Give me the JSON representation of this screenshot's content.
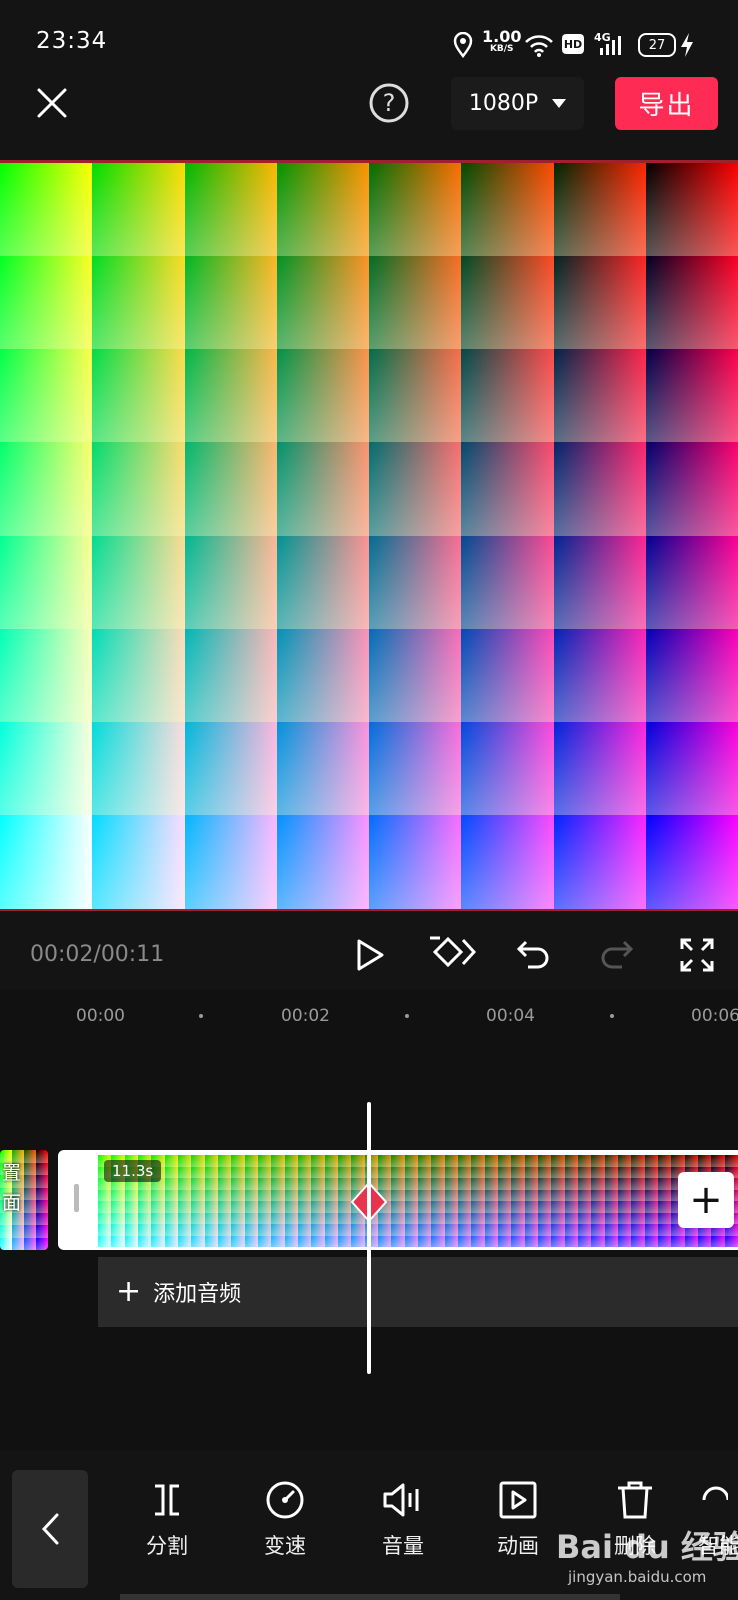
{
  "status_bar": {
    "time": "23:34",
    "speed_value": "1.00",
    "speed_unit": "KB/S",
    "hd": "HD",
    "network": "4G",
    "battery": "27",
    "icons": [
      "location-icon",
      "wifi-icon",
      "signal-icon",
      "battery-icon",
      "charging-icon"
    ]
  },
  "topbar": {
    "resolution": "1080P",
    "export_label": "导出",
    "icons": [
      "close-icon",
      "help-icon",
      "caret-down-icon"
    ]
  },
  "player": {
    "time": "00:02/00:11",
    "icons": [
      "play-icon",
      "keyframe-icon",
      "undo-icon",
      "redo-icon",
      "fullscreen-icon"
    ]
  },
  "ruler": {
    "ticks": [
      "00:00",
      "00:02",
      "00:04",
      "00:06"
    ]
  },
  "timeline": {
    "cover_label_1": "置",
    "cover_label_2": "面",
    "duration": "11.3s",
    "add_clip": "+",
    "add_audio_label": "添加音频",
    "playhead_position_seconds": 2.5
  },
  "toolbar": {
    "items": [
      {
        "label": "分割",
        "icon": "split-icon"
      },
      {
        "label": "变速",
        "icon": "speed-icon"
      },
      {
        "label": "音量",
        "icon": "volume-icon"
      },
      {
        "label": "动画",
        "icon": "animation-icon"
      },
      {
        "label": "删除",
        "icon": "delete-icon"
      },
      {
        "label": "智能",
        "icon": "smart-icon"
      }
    ]
  },
  "watermark": {
    "brand": "Bai du 经验",
    "url": "jingyan.baidu.com"
  },
  "colors": {
    "accent": "#fe2c55",
    "background": "#141414",
    "keyframe": "#e8334f"
  }
}
